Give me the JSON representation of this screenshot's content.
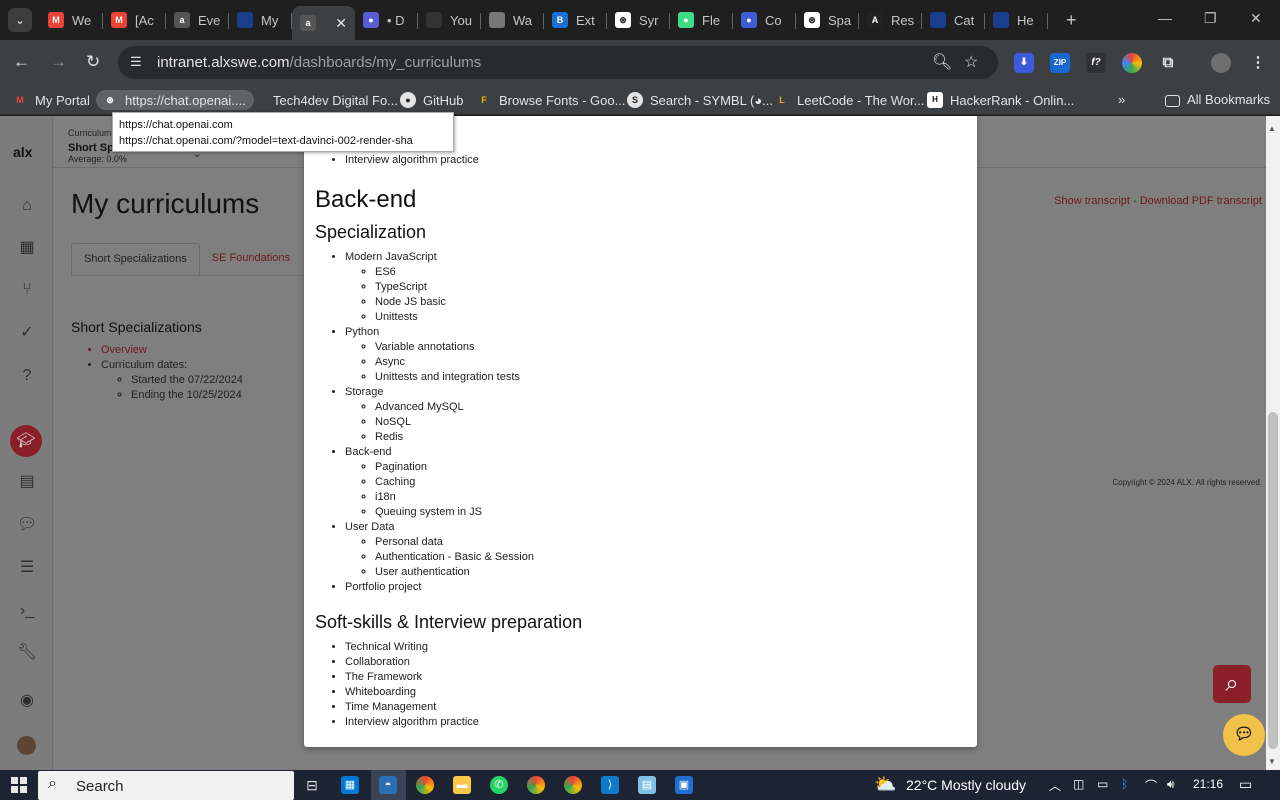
{
  "browser": {
    "tabs": [
      {
        "title": "We",
        "icon": "gmail-icon",
        "color": "#ea4335",
        "glyph": "M"
      },
      {
        "title": "[Ac",
        "icon": "gmail-icon",
        "color": "#ea4335",
        "glyph": "M"
      },
      {
        "title": "Eve",
        "icon": "alx-icon",
        "color": "#555555",
        "glyph": "a"
      },
      {
        "title": "My",
        "icon": "doc-icon",
        "color": "#1a3d8f",
        "glyph": ""
      },
      {
        "title": "",
        "icon": "alx-icon",
        "color": "#555555",
        "glyph": "a",
        "active": true
      },
      {
        "title": "• D",
        "icon": "chrome-ext-icon",
        "color": "#5b5bd6",
        "glyph": "●"
      },
      {
        "title": "You",
        "icon": "github-icon",
        "color": "#333333",
        "glyph": ""
      },
      {
        "title": "Wa",
        "icon": "globe-icon",
        "color": "#777777",
        "glyph": ""
      },
      {
        "title": "Ext",
        "icon": "b-icon",
        "color": "#1b6fd1",
        "glyph": "B"
      },
      {
        "title": "Syr",
        "icon": "openai-icon",
        "color": "#ffffff",
        "glyph": "⊛"
      },
      {
        "title": "Fle",
        "icon": "android-icon",
        "color": "#3ddc84",
        "glyph": "●"
      },
      {
        "title": "Co",
        "icon": "circle-icon",
        "color": "#3c5fd6",
        "glyph": "●"
      },
      {
        "title": "Spa",
        "icon": "openai-icon",
        "color": "#ffffff",
        "glyph": "⊛"
      },
      {
        "title": "Res",
        "icon": "a-icon",
        "color": "#222222",
        "glyph": "A"
      },
      {
        "title": "Cat",
        "icon": "doc-icon",
        "color": "#1a3d8f",
        "glyph": ""
      },
      {
        "title": "He",
        "icon": "doc-icon",
        "color": "#1a3d8f",
        "glyph": ""
      }
    ],
    "url_host": "intranet.alxswe.com",
    "url_path": "/dashboards/my_curriculums"
  },
  "bookmarks": {
    "items": [
      {
        "label": "My Portal",
        "glyph": "M",
        "color": "#ea4335"
      },
      {
        "label": "https://chat.openai....",
        "glyph": "⊛",
        "color": "#444444"
      },
      {
        "label": "Tech4dev Digital Fo...",
        "glyph": "",
        "color": "#3c4043"
      },
      {
        "label": "GitHub",
        "glyph": "●",
        "color": "#222222"
      },
      {
        "label": "Browse Fonts - Goo...",
        "glyph": "F",
        "color": "#f4b400"
      },
      {
        "label": "Search - SYMBL (◕...",
        "glyph": "S",
        "color": "#222222"
      },
      {
        "label": "LeetCode - The Wor...",
        "glyph": "L",
        "color": "#ffa116"
      },
      {
        "label": "HackerRank - Onlin...",
        "glyph": "H",
        "color": "#1ba94c"
      }
    ],
    "more": "»",
    "all": "All Bookmarks"
  },
  "tooltip": {
    "line1": "https://chat.openai.com",
    "line2": "https://chat.openai.com/?model=text-davinci-002-render-sha"
  },
  "header": {
    "curriculum_label": "Curriculum",
    "curriculum_name": "Short Specializations",
    "average": "Average: 0.0%"
  },
  "page": {
    "title": "My curriculums",
    "show_transcript": "Show transcript",
    "download_transcript": "Download PDF transcript",
    "tabs": [
      "Short Specializations",
      "SE Foundations"
    ],
    "subtitle": "Short Specializations",
    "overview": "Overview",
    "dates_label": "Curriculum dates:",
    "started": "Started the 07/22/2024",
    "ending": "Ending the 10/25/2024",
    "copyright": "Copyright © 2024 ALX. All rights reserved."
  },
  "modal": {
    "top_item": "Interview algorithm practice",
    "section_title": "Back-end",
    "spec_title": "Specialization",
    "spec_items": [
      {
        "label": "Modern JavaScript",
        "children": [
          "ES6",
          "TypeScript",
          "Node JS basic",
          "Unittests"
        ]
      },
      {
        "label": "Python",
        "children": [
          "Variable annotations",
          "Async",
          "Unittests and integration tests"
        ]
      },
      {
        "label": "Storage",
        "children": [
          "Advanced MySQL",
          "NoSQL",
          "Redis"
        ]
      },
      {
        "label": "Back-end",
        "children": [
          "Pagination",
          "Caching",
          "i18n",
          "Queuing system in JS"
        ]
      },
      {
        "label": "User Data",
        "children": [
          "Personal data",
          "Authentication - Basic & Session",
          "User authentication"
        ]
      },
      {
        "label": "Portfolio project",
        "children": []
      }
    ],
    "soft_title": "Soft-skills & Interview preparation",
    "soft_items": [
      "Technical Writing",
      "Collaboration",
      "The Framework",
      "Whiteboarding",
      "Time Management",
      "Interview algorithm practice"
    ]
  },
  "taskbar": {
    "search_label": "Search",
    "weather": "22°C  Mostly cloudy",
    "time": "21:16"
  }
}
